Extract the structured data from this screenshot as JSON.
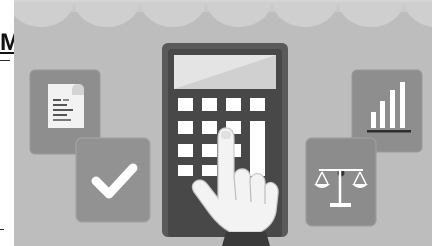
{
  "edge_caption": "M",
  "scene": {
    "icons": [
      "receipt-icon",
      "checkmark-icon",
      "calculator-icon",
      "pointing-hand-icon",
      "bar-chart-icon",
      "balance-scale-icon"
    ],
    "colors": {
      "background": "#bdbdbd",
      "scallop": "#cdcdcd",
      "card": "#8e8e8e",
      "card_dark": "#7c7c7c",
      "calculator_body": "#4a4a4a",
      "calculator_frame": "#5c5c5c",
      "screen": "#e2e2e2",
      "keys": "#ffffff",
      "hand": "#f4f4f4",
      "sleeve": "#3a3a3a"
    }
  }
}
